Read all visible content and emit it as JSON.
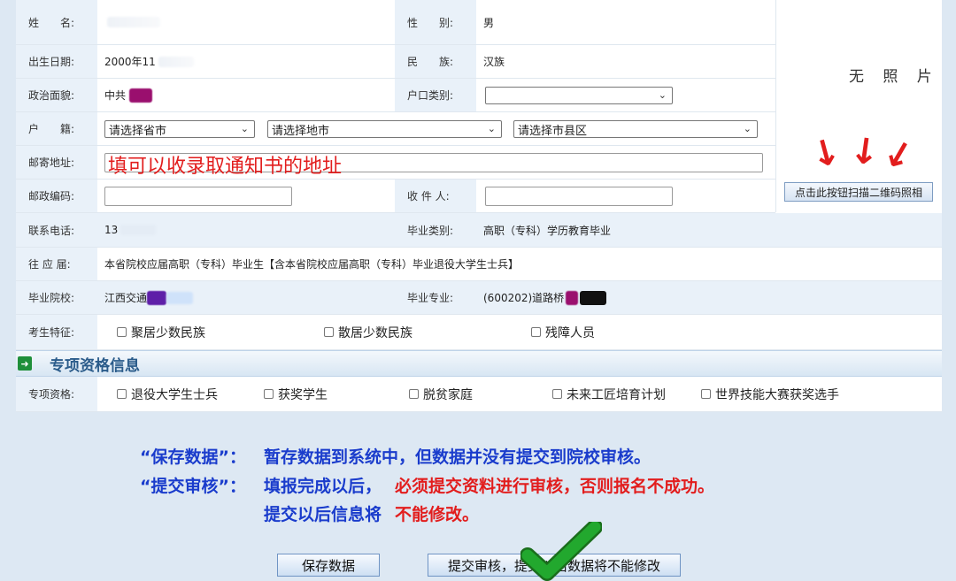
{
  "fields": {
    "name": {
      "label": "姓　　名:"
    },
    "gender": {
      "label": "性　　别:",
      "value": "男"
    },
    "birth": {
      "label": "出生日期:",
      "value": "2000年11"
    },
    "ethnicity": {
      "label": "民　　族:",
      "value": "汉族"
    },
    "political": {
      "label": "政治面貌:",
      "value": "中共"
    },
    "hukou_type": {
      "label": "户口类别:"
    },
    "hukou": {
      "label": "户　　籍:",
      "province": "请选择省市",
      "city": "请选择地市",
      "county": "请选择市县区"
    },
    "address": {
      "label": "邮寄地址:"
    },
    "postcode": {
      "label": "邮政编码:"
    },
    "receiver": {
      "label": "收 件 人:"
    },
    "phone": {
      "label": "联系电话:",
      "value": "13"
    },
    "grad_type": {
      "label": "毕业类别:",
      "value": "高职（专科）学历教育毕业"
    },
    "cohort": {
      "label": "往 应 届:",
      "value": "本省院校应届高职（专科）毕业生【含本省院校应届高职（专科）毕业退役大学生士兵】"
    },
    "school": {
      "label": "毕业院校:",
      "value": "江西交通"
    },
    "major": {
      "label": "毕业专业:",
      "value": "(600202)道路桥"
    },
    "features": {
      "label": "考生特征:",
      "options": [
        "聚居少数民族",
        "散居少数民族",
        "残障人员"
      ]
    }
  },
  "photo": {
    "placeholder": "无 照 片",
    "qr_button": "点击此按钮扫描二维码照相"
  },
  "section": {
    "icon": "arrow-right-icon",
    "title": "专项资格信息"
  },
  "special": {
    "label": "专项资格:",
    "options": [
      "退役大学生士兵",
      "获奖学生",
      "脱贫家庭",
      "未来工匠培育计划",
      "世界技能大赛获奖选手"
    ]
  },
  "annotations": {
    "address_hint": "填可以收录取通知书的地址",
    "save_title": "“保存数据”：",
    "save_desc": "暂存数据到系统中，但数据并没有提交到院校审核。",
    "submit_title": "“提交审核”：",
    "submit_desc_a": "填报完成以后，",
    "submit_desc_b": "必须提交资料进行审核，否则报名不成功。",
    "after_a": "提交以后信息将",
    "after_b": "不能修改。"
  },
  "buttons": {
    "save": "保存数据",
    "submit": "提交审核，提交以后数据将不能修改"
  },
  "colors": {
    "annotation_blue": "#1a3ccc",
    "annotation_red": "#e21d1d",
    "check_green": "#22a82e",
    "label_bg": "#e9f1f9"
  }
}
